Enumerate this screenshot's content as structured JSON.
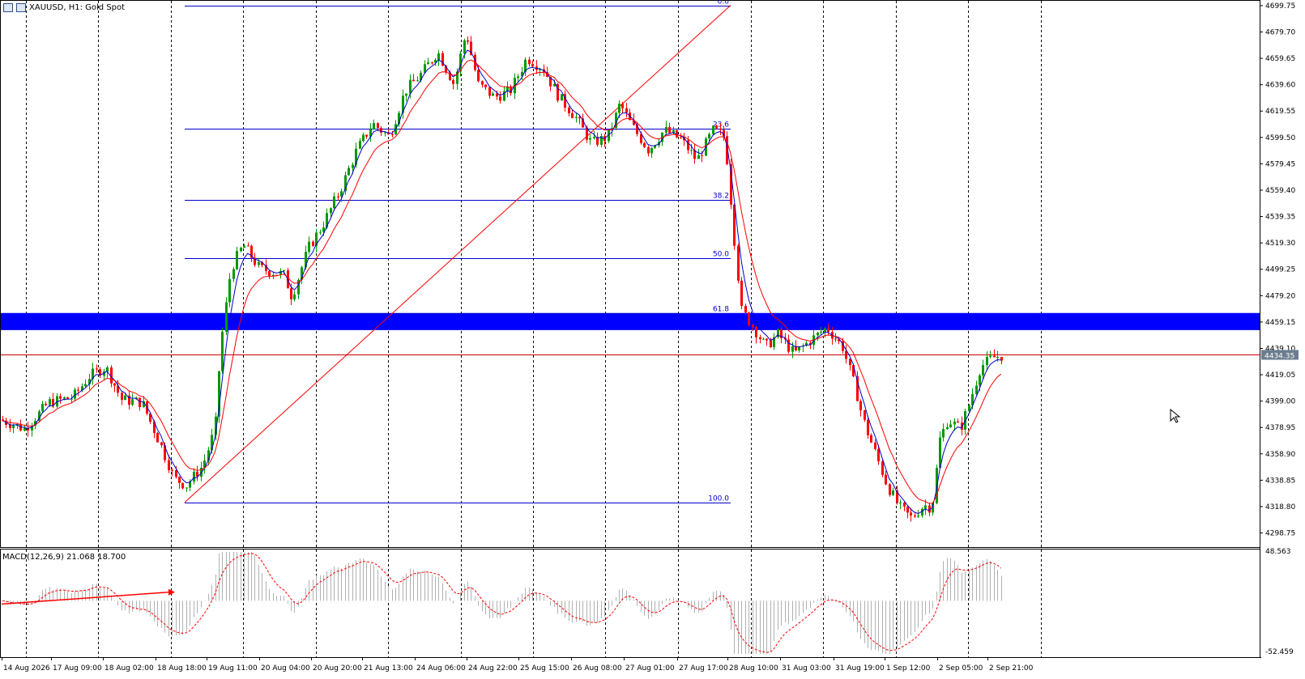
{
  "symbol_title": "XAUUSD, H1:  Gold Spot",
  "macd_label": "MACD(12,26,9) 21.068 18.700",
  "current_price": "4434.35",
  "price_ticks": [
    "4699.75",
    "4679.70",
    "4659.65",
    "4639.60",
    "4619.55",
    "4599.50",
    "4579.45",
    "4559.40",
    "4539.35",
    "4519.30",
    "4499.25",
    "4479.20",
    "4459.15",
    "4439.10",
    "4419.05",
    "4399.00",
    "4378.95",
    "4358.90",
    "4338.85",
    "4318.80",
    "4298.75"
  ],
  "macd_ticks": [
    "48.563",
    "-52.459"
  ],
  "time_labels": [
    "14 Aug 2026",
    "17 Aug 09:00",
    "18 Aug 02:00",
    "18 Aug 18:00",
    "19 Aug 11:00",
    "20 Aug 04:00",
    "20 Aug 20:00",
    "21 Aug 13:00",
    "24 Aug 06:00",
    "24 Aug 22:00",
    "25 Aug 15:00",
    "26 Aug 08:00",
    "27 Aug 01:00",
    "27 Aug 17:00",
    "28 Aug 10:00",
    "31 Aug 03:00",
    "31 Aug 19:00",
    "1 Sep 12:00",
    "2 Sep 05:00",
    "2 Sep 21:00"
  ],
  "fib_levels": [
    {
      "label": "0.0",
      "price": 4700
    },
    {
      "label": "23.6",
      "price": 4606
    },
    {
      "label": "38.2",
      "price": 4552
    },
    {
      "label": "50.0",
      "price": 4508
    },
    {
      "label": "61.8",
      "price": 4466
    },
    {
      "label": "100.0",
      "price": 4322
    }
  ],
  "support_zone": {
    "top_price": 4466,
    "bottom_price": 4453,
    "color": "#0000ff"
  },
  "colors": {
    "bull": "#009900",
    "bear": "#ff0000",
    "ma_fast": "#0000cc",
    "ma_slow": "#ff0000",
    "fib": "#0000cc",
    "grid": "#000000",
    "price_line": "#cc0000"
  },
  "chart_data": {
    "type": "candlestick",
    "symbol": "XAUUSD",
    "timeframe": "H1",
    "ylim": [
      4288,
      4704
    ],
    "macd_ylim": [
      -52.459,
      48.563
    ],
    "macd": {
      "main": 21.068,
      "signal": 18.7
    },
    "last_price": 4434.35,
    "path_anchors": [
      [
        0,
        4385
      ],
      [
        30,
        4378
      ],
      [
        60,
        4398
      ],
      [
        90,
        4402
      ],
      [
        110,
        4418
      ],
      [
        130,
        4425
      ],
      [
        150,
        4400
      ],
      [
        175,
        4398
      ],
      [
        195,
        4370
      ],
      [
        215,
        4340
      ],
      [
        230,
        4335
      ],
      [
        250,
        4350
      ],
      [
        265,
        4378
      ],
      [
        272,
        4440
      ],
      [
        285,
        4500
      ],
      [
        300,
        4518
      ],
      [
        320,
        4500
      ],
      [
        350,
        4495
      ],
      [
        360,
        4478
      ],
      [
        380,
        4515
      ],
      [
        400,
        4535
      ],
      [
        420,
        4560
      ],
      [
        440,
        4590
      ],
      [
        460,
        4610
      ],
      [
        480,
        4600
      ],
      [
        500,
        4635
      ],
      [
        520,
        4648
      ],
      [
        540,
        4665
      ],
      [
        560,
        4640
      ],
      [
        575,
        4680
      ],
      [
        590,
        4640
      ],
      [
        610,
        4630
      ],
      [
        630,
        4635
      ],
      [
        650,
        4660
      ],
      [
        670,
        4652
      ],
      [
        690,
        4630
      ],
      [
        710,
        4615
      ],
      [
        730,
        4595
      ],
      [
        750,
        4600
      ],
      [
        765,
        4625
      ],
      [
        780,
        4608
      ],
      [
        800,
        4590
      ],
      [
        820,
        4605
      ],
      [
        840,
        4598
      ],
      [
        860,
        4582
      ],
      [
        880,
        4605
      ],
      [
        895,
        4600
      ],
      [
        905,
        4530
      ],
      [
        915,
        4468
      ],
      [
        930,
        4455
      ],
      [
        945,
        4440
      ],
      [
        960,
        4450
      ],
      [
        980,
        4435
      ],
      [
        1000,
        4445
      ],
      [
        1020,
        4455
      ],
      [
        1040,
        4440
      ],
      [
        1055,
        4410
      ],
      [
        1065,
        4385
      ],
      [
        1080,
        4360
      ],
      [
        1095,
        4335
      ],
      [
        1110,
        4318
      ],
      [
        1125,
        4310
      ],
      [
        1140,
        4320
      ],
      [
        1150,
        4318
      ],
      [
        1160,
        4370
      ],
      [
        1170,
        4385
      ],
      [
        1185,
        4378
      ],
      [
        1195,
        4395
      ],
      [
        1210,
        4425
      ],
      [
        1225,
        4432
      ],
      [
        1238,
        4434
      ]
    ]
  }
}
